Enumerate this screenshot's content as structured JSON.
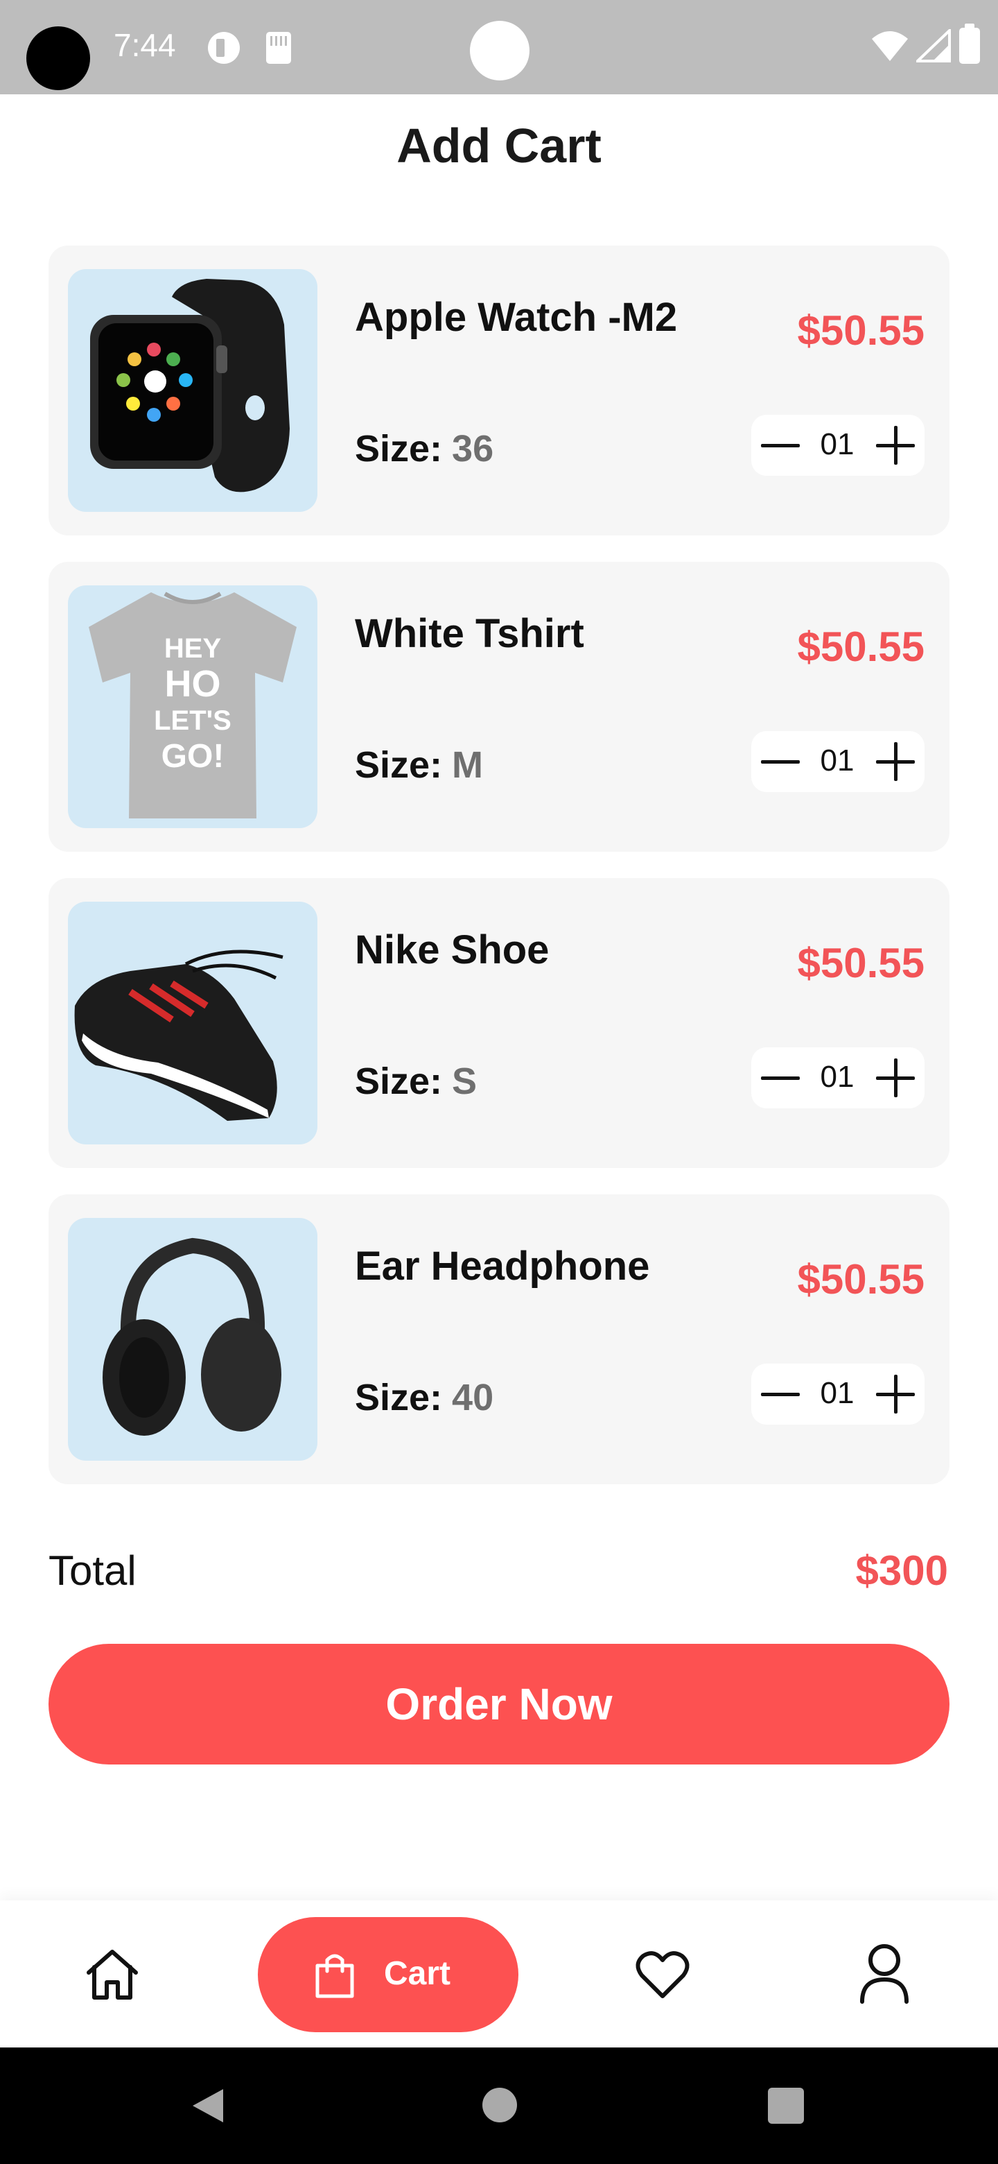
{
  "status_bar": {
    "time": "7:44"
  },
  "page": {
    "title": "Add Cart"
  },
  "cart": {
    "items": [
      {
        "name": "Apple Watch -M2",
        "price": "$50.55",
        "size_label": "Size:",
        "size": "36",
        "quantity": "01",
        "image": "apple-watch-image"
      },
      {
        "name": "White Tshirt",
        "price": "$50.55",
        "size_label": "Size:",
        "size": "M",
        "quantity": "01",
        "image": "tshirt-image"
      },
      {
        "name": "Nike Shoe",
        "price": "$50.55",
        "size_label": "Size:",
        "size": "S",
        "quantity": "01",
        "image": "shoe-image"
      },
      {
        "name": "Ear Headphone",
        "price": "$50.55",
        "size_label": "Size:",
        "size": "40",
        "quantity": "01",
        "image": "headphone-image"
      }
    ],
    "tshirt_print": [
      "HEY",
      "HO",
      "LET'S",
      "GO!"
    ],
    "total_label": "Total",
    "total_value": "$300",
    "order_button": "Order Now"
  },
  "bottom_nav": {
    "items": [
      {
        "icon": "home-icon"
      },
      {
        "icon": "shopping-bag-icon",
        "label": "Cart",
        "active": true
      },
      {
        "icon": "heart-icon"
      },
      {
        "icon": "profile-icon"
      }
    ]
  },
  "colors": {
    "accent": "#fd5151",
    "price": "#f25457",
    "card_bg": "#f6f6f6",
    "thumb_bg": "#d3e9f6"
  }
}
